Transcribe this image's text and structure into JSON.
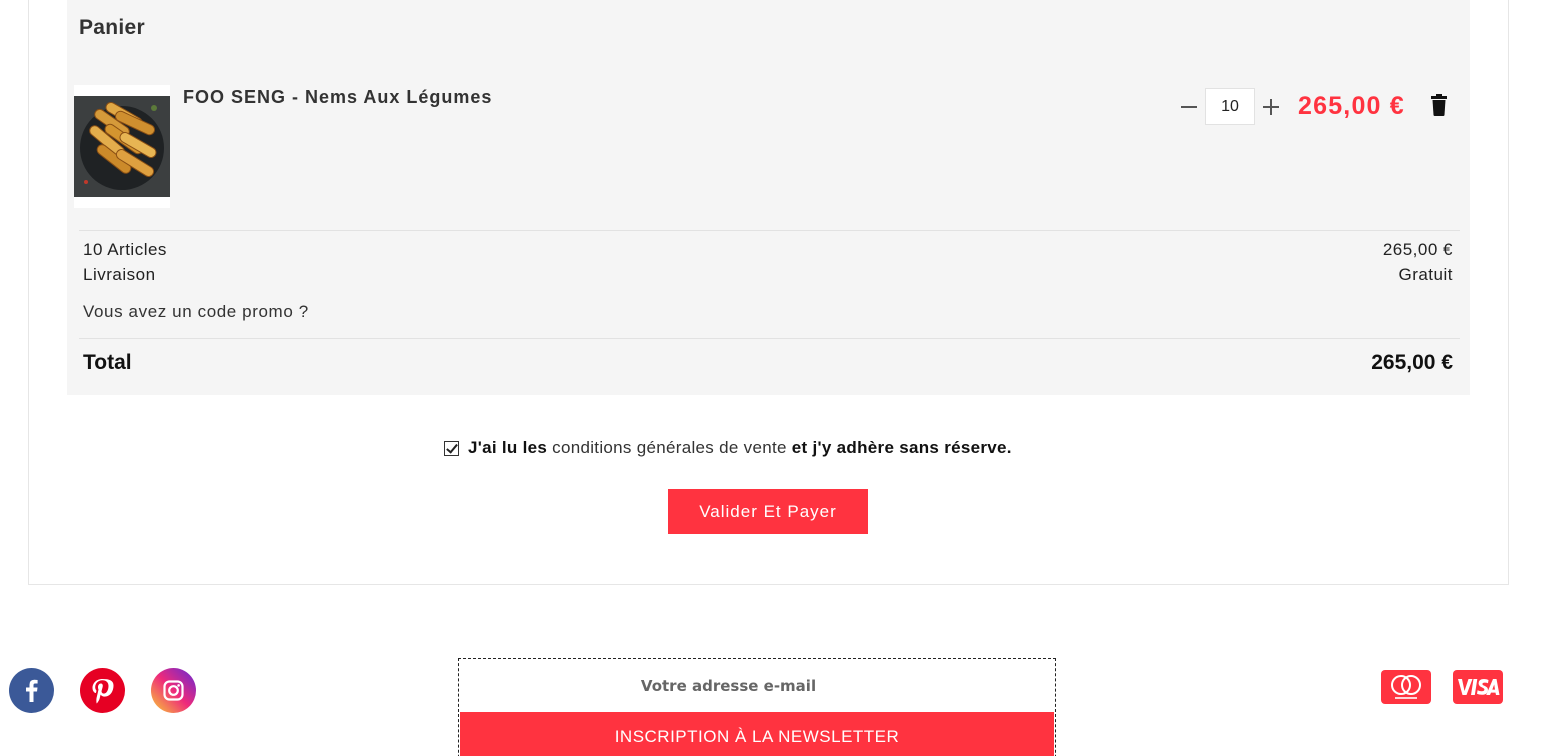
{
  "cart": {
    "title": "Panier",
    "item": {
      "name": "FOO SENG - Nems Aux Légumes",
      "quantity": "10",
      "price": "265,00 €",
      "image_alt": "Nems aux légumes"
    },
    "summary": {
      "articles_label": "10 Articles",
      "articles_value": "265,00 €",
      "shipping_label": "Livraison",
      "shipping_value": "Gratuit",
      "promo_link": "Vous avez un code promo ?",
      "total_label": "Total",
      "total_value": "265,00 €"
    }
  },
  "terms": {
    "checked": true,
    "text_before": "J'ai lu les",
    "link": "conditions générales de vente",
    "text_after": "et j'y adhère sans réserve."
  },
  "checkout": {
    "button_label": "Valider Et Payer"
  },
  "footer": {
    "social": [
      "facebook-icon",
      "pinterest-icon",
      "instagram-icon"
    ],
    "newsletter": {
      "placeholder": "Votre adresse e-mail",
      "button_label": "INSCRIPTION À LA NEWSLETTER"
    },
    "payment_methods": [
      "mastercard-icon",
      "visa-icon"
    ]
  },
  "colors": {
    "accent": "#ff3340",
    "panel_bg": "#f5f5f5",
    "facebook": "#3b5998",
    "pinterest": "#e60023"
  }
}
